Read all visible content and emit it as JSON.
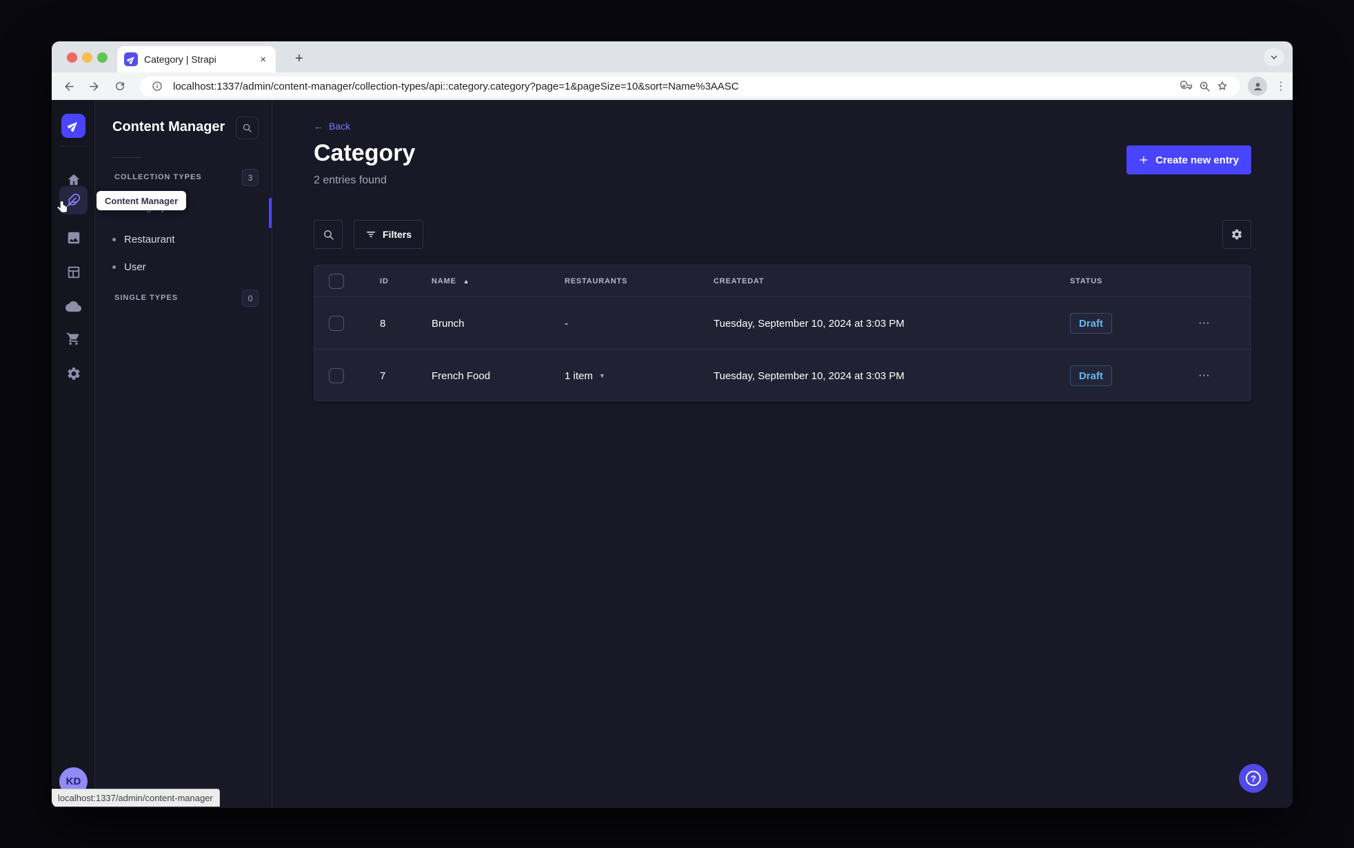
{
  "browser": {
    "tab_title": "Category | Strapi",
    "new_tab_glyph": "+",
    "close_glyph": "×",
    "url": "localhost:1337/admin/content-manager/collection-types/api::category.category?page=1&pageSize=10&sort=Name%3AASC",
    "kebab_glyph": "⋮",
    "status_bar_link": "localhost:1337/admin/content-manager"
  },
  "nav": {
    "tooltip": "Content Manager",
    "avatar_initials": "KD"
  },
  "panel": {
    "title": "Content Manager",
    "collection_types": {
      "label": "COLLECTION TYPES",
      "badge": "3",
      "items": [
        {
          "label": "Category",
          "active": true
        },
        {
          "label": "Restaurant",
          "active": false
        },
        {
          "label": "User",
          "active": false
        }
      ]
    },
    "single_types": {
      "label": "SINGLE TYPES",
      "badge": "0"
    }
  },
  "main": {
    "back_label": "Back",
    "back_arrow": "←",
    "title": "Category",
    "subtitle": "2 entries found",
    "create_button": "Create new entry",
    "filters_button": "Filters",
    "table": {
      "headers": [
        "ID",
        "NAME",
        "RESTAURANTS",
        "CREATEDAT",
        "STATUS"
      ],
      "sort_caret": "▲",
      "rows": [
        {
          "id": "8",
          "name": "Brunch",
          "restaurants": "-",
          "createdAt": "Tuesday, September 10, 2024 at 3:03 PM",
          "status": "Draft"
        },
        {
          "id": "7",
          "name": "French Food",
          "restaurants": "1 item",
          "createdAt": "Tuesday, September 10, 2024 at 3:03 PM",
          "status": "Draft"
        }
      ],
      "row_caret": "▼",
      "row_actions_glyph": "⋯"
    },
    "help_glyph": "?"
  },
  "colors": {
    "brand": "#4945ff",
    "link": "#7b79ff",
    "draft_status": "#66b7f1",
    "page_bg": "#181826",
    "card_bg": "#212134"
  }
}
